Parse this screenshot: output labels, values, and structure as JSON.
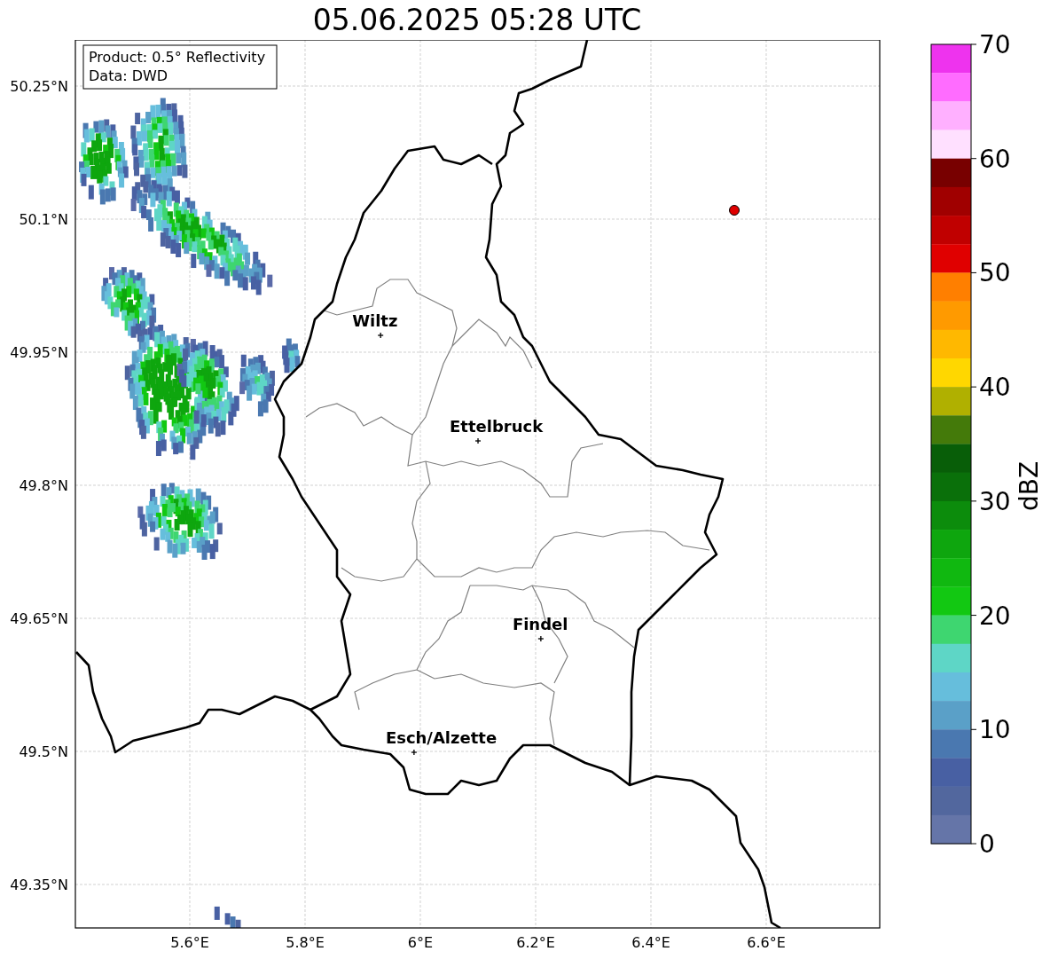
{
  "title": "05.06.2025 05:28 UTC",
  "info_box": {
    "lines": [
      "Product: 0.5° Reflectivity",
      "Data: DWD"
    ]
  },
  "map": {
    "lat_ticks": [
      "50.25°N",
      "50.1°N",
      "49.95°N",
      "49.8°N",
      "49.65°N",
      "49.5°N",
      "49.35°N"
    ],
    "lon_ticks": [
      "5.6°E",
      "5.8°E",
      "6°E",
      "6.2°E",
      "6.4°E",
      "6.6°E"
    ],
    "cities": [
      {
        "name": "Wiltz"
      },
      {
        "name": "Ettelbruck"
      },
      {
        "name": "Findel"
      },
      {
        "name": "Esch/Alzette"
      }
    ]
  },
  "colorbar": {
    "label": "dBZ",
    "ticks": [
      "70",
      "60",
      "50",
      "40",
      "30",
      "20",
      "10",
      "0"
    ],
    "bins": [
      {
        "color": "#ee33ee"
      },
      {
        "color": "#ff6cff"
      },
      {
        "color": "#ffb0ff"
      },
      {
        "color": "#ffe0ff"
      },
      {
        "color": "#780000"
      },
      {
        "color": "#a00000"
      },
      {
        "color": "#c00000"
      },
      {
        "color": "#e00000"
      },
      {
        "color": "#ff7f00"
      },
      {
        "color": "#ff9a00"
      },
      {
        "color": "#ffb800"
      },
      {
        "color": "#ffd700"
      },
      {
        "color": "#b0b000"
      },
      {
        "color": "#447a0a"
      },
      {
        "color": "#085e08"
      },
      {
        "color": "#0a700a"
      },
      {
        "color": "#0c8c0c"
      },
      {
        "color": "#0ea60e"
      },
      {
        "color": "#10b810"
      },
      {
        "color": "#12c812"
      },
      {
        "color": "#3ed670"
      },
      {
        "color": "#5ed6c6"
      },
      {
        "color": "#66bedc"
      },
      {
        "color": "#5aa0c8"
      },
      {
        "color": "#4a78b0"
      },
      {
        "color": "#4860a3"
      },
      {
        "color": "#52679e"
      },
      {
        "color": "#6575a8"
      }
    ]
  }
}
